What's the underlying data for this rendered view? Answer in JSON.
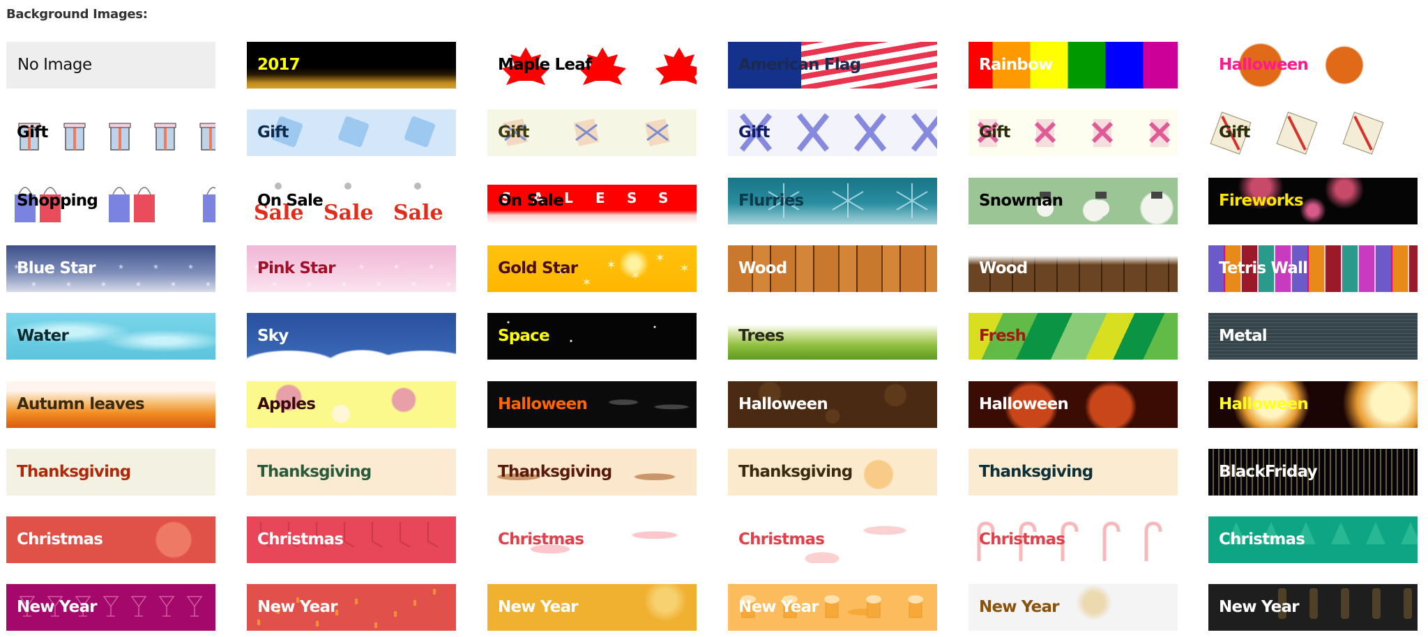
{
  "header": {
    "title": "Background Images:"
  },
  "tiles": [
    {
      "label": "No Image",
      "color": "#111111",
      "bg": "#eeeeee",
      "pattern": "none",
      "icon": "none"
    },
    {
      "label": "2017",
      "color": "#ffff00",
      "bg": "#000000",
      "pattern": "gold-bottom",
      "icon": "year-2017-icon"
    },
    {
      "label": "Maple Leaf",
      "color": "#000000",
      "bg": "#ffffff",
      "pattern": "maple",
      "icon": "maple-leaf-icon"
    },
    {
      "label": "American Flag",
      "color": "#1a2a50",
      "bg": "#ffffff",
      "pattern": "flag",
      "icon": "flag-icon"
    },
    {
      "label": "Rainbow",
      "color": "#ffffff",
      "bg": "#ffffff",
      "pattern": "rainbow",
      "icon": "rainbow-stripes-icon"
    },
    {
      "label": "Halloween",
      "color": "#ff1a8c",
      "bg": "#ffffff",
      "pattern": "pumpkin-white",
      "icon": "pumpkin-icon"
    },
    {
      "label": "Gift",
      "color": "#000000",
      "bg": "#ffffff",
      "pattern": "gift-outline",
      "icon": "gift-icon"
    },
    {
      "label": "Gift",
      "color": "#0d2a4d",
      "bg": "#d4e6fa",
      "pattern": "gift-blue",
      "icon": "gift-icon"
    },
    {
      "label": "Gift",
      "color": "#3a3a0a",
      "bg": "#f5f6e4",
      "pattern": "gift-beige",
      "icon": "gift-icon"
    },
    {
      "label": "Gift",
      "color": "#101a66",
      "bg": "#f2f3fb",
      "pattern": "gift-purple",
      "icon": "gift-icon"
    },
    {
      "label": "Gift",
      "color": "#2b2b0a",
      "bg": "#fdfdf0",
      "pattern": "gift-pink",
      "icon": "gift-icon"
    },
    {
      "label": "Gift",
      "color": "#2b2b0a",
      "bg": "#ffffff",
      "pattern": "gift-red",
      "icon": "gift-icon"
    },
    {
      "label": "Shopping",
      "color": "#000000",
      "bg": "#ffffff",
      "pattern": "bags",
      "icon": "shopping-bag-icon"
    },
    {
      "label": "On Sale",
      "color": "#000000",
      "bg": "#ffffff",
      "pattern": "sale-3d",
      "icon": "sale-icon"
    },
    {
      "label": "On Sale",
      "color": "#000000",
      "bg": "#ffffff",
      "pattern": "sale-blocks",
      "icon": "sale-icon"
    },
    {
      "label": "Flurries",
      "color": "#0d3a4a",
      "bg": "#1c7a8e",
      "pattern": "snowflake",
      "icon": "snowflake-icon"
    },
    {
      "label": "Snowman",
      "color": "#000000",
      "bg": "#9cc596",
      "pattern": "snowman",
      "icon": "snowman-icon"
    },
    {
      "label": "Fireworks",
      "color": "#ffe600",
      "bg": "#050505",
      "pattern": "fireworks",
      "icon": "fireworks-icon"
    },
    {
      "label": "Blue Star",
      "color": "#ffffff",
      "bg": "#5a6aa0",
      "pattern": "stars-blue",
      "icon": "star-icon"
    },
    {
      "label": "Pink Star",
      "color": "#a0102a",
      "bg": "#f5c0dc",
      "pattern": "stars-pink",
      "icon": "star-icon"
    },
    {
      "label": "Gold Star",
      "color": "#4a0e0e",
      "bg": "#ffc20e",
      "pattern": "stars-gold",
      "icon": "star-icon"
    },
    {
      "label": "Wood",
      "color": "#ffffff",
      "bg": "#c9782e",
      "pattern": "wood-light",
      "icon": "wood-plank-icon"
    },
    {
      "label": "Wood",
      "color": "#ffffff",
      "bg": "#6b4523",
      "pattern": "wood-snow",
      "icon": "wood-plank-icon"
    },
    {
      "label": "Tetris Wall",
      "color": "#ffffff",
      "bg": "#f6c8f0",
      "pattern": "tetris",
      "icon": "brick-wall-icon"
    },
    {
      "label": "Water",
      "color": "#0a2a30",
      "bg": "#6fd0e6",
      "pattern": "water",
      "icon": "water-icon"
    },
    {
      "label": "Sky",
      "color": "#ffffff",
      "bg": "#2d58a8",
      "pattern": "sky",
      "icon": "cloud-icon"
    },
    {
      "label": "Space",
      "color": "#ffff00",
      "bg": "#050505",
      "pattern": "space",
      "icon": "space-icon"
    },
    {
      "label": "Trees",
      "color": "#2a2a1a",
      "bg": "#ffffff",
      "pattern": "grass",
      "icon": "grass-icon"
    },
    {
      "label": "Fresh",
      "color": "#a01a10",
      "bg": "#62bb46",
      "pattern": "fresh",
      "icon": "stripes-icon"
    },
    {
      "label": "Metal",
      "color": "#ffffff",
      "bg": "#38474c",
      "pattern": "metal",
      "icon": "metal-icon"
    },
    {
      "label": "Autumn leaves",
      "color": "#3a2a10",
      "bg": "#f5b050",
      "pattern": "autumn",
      "icon": "leaf-icon"
    },
    {
      "label": "Apples",
      "color": "#3a0a0a",
      "bg": "#fbf88c",
      "pattern": "apples",
      "icon": "apple-icon"
    },
    {
      "label": "Halloween",
      "color": "#ff6600",
      "bg": "#0b0b0b",
      "pattern": "ghosts",
      "icon": "ghost-icon"
    },
    {
      "label": "Halloween",
      "color": "#ffffff",
      "bg": "#4a2a12",
      "pattern": "pumpkin-faces",
      "icon": "pumpkin-icon"
    },
    {
      "label": "Halloween",
      "color": "#ffffff",
      "bg": "#3a0c04",
      "pattern": "pumpkin-dark",
      "icon": "pumpkin-icon"
    },
    {
      "label": "Halloween",
      "color": "#ffff22",
      "bg": "#1a0404",
      "pattern": "lantern",
      "icon": "pumpkin-icon"
    },
    {
      "label": "Thanksgiving",
      "color": "#b0280a",
      "bg": "#f3f1e2",
      "pattern": "leaves-outline",
      "icon": "leaf-icon"
    },
    {
      "label": "Thanksgiving",
      "color": "#2a5a3a",
      "bg": "#fcebd3",
      "pattern": "maple-pastel",
      "icon": "leaf-icon"
    },
    {
      "label": "Thanksgiving",
      "color": "#5a1a0a",
      "bg": "#fbe7cc",
      "pattern": "turkey",
      "icon": "turkey-icon"
    },
    {
      "label": "Thanksgiving",
      "color": "#3a2a10",
      "bg": "#fbebcc",
      "pattern": "pumpkins",
      "icon": "pumpkin-icon"
    },
    {
      "label": "Thanksgiving",
      "color": "#0d3038",
      "bg": "#fbebd0",
      "pattern": "turkey-outline",
      "icon": "turkey-icon"
    },
    {
      "label": "BlackFriday",
      "color": "#ffffff",
      "bg": "#050505",
      "pattern": "friday",
      "icon": "dollar-icon"
    },
    {
      "label": "Christmas",
      "color": "#ffffff",
      "bg": "#e05148",
      "pattern": "presents",
      "icon": "gift-icon"
    },
    {
      "label": "Christmas",
      "color": "#ffffff",
      "bg": "#e8475a",
      "pattern": "stockings",
      "icon": "stocking-icon"
    },
    {
      "label": "Christmas",
      "color": "#e0404a",
      "bg": "#ffffff",
      "pattern": "mittens",
      "icon": "mitten-icon"
    },
    {
      "label": "Christmas",
      "color": "#e0404a",
      "bg": "#ffffff",
      "pattern": "santa-hats",
      "icon": "santa-hat-icon"
    },
    {
      "label": "Christmas",
      "color": "#e0404a",
      "bg": "#ffffff",
      "pattern": "candy-canes",
      "icon": "candy-cane-icon"
    },
    {
      "label": "Christmas",
      "color": "#ffffff",
      "bg": "#0ea585",
      "pattern": "trees-green",
      "icon": "christmas-tree-icon"
    },
    {
      "label": "New Year",
      "color": "#ffffff",
      "bg": "#a3086a",
      "pattern": "martini",
      "icon": "cocktail-icon"
    },
    {
      "label": "New Year",
      "color": "#ffffff",
      "bg": "#e2504c",
      "pattern": "confetti",
      "icon": "confetti-icon"
    },
    {
      "label": "New Year",
      "color": "#ffffff",
      "bg": "#f0b030",
      "pattern": "sparklers",
      "icon": "sparkler-icon"
    },
    {
      "label": "New Year",
      "color": "#ffffff",
      "bg": "#fcbb5c",
      "pattern": "beer",
      "icon": "beer-mug-icon"
    },
    {
      "label": "New Year",
      "color": "#8a5208",
      "bg": "#f4f4f4",
      "pattern": "snowflake-gold",
      "icon": "snowflake-icon"
    },
    {
      "label": "New Year",
      "color": "#ffffff",
      "bg": "#1e1e1e",
      "pattern": "champagne",
      "icon": "champagne-icon"
    }
  ]
}
